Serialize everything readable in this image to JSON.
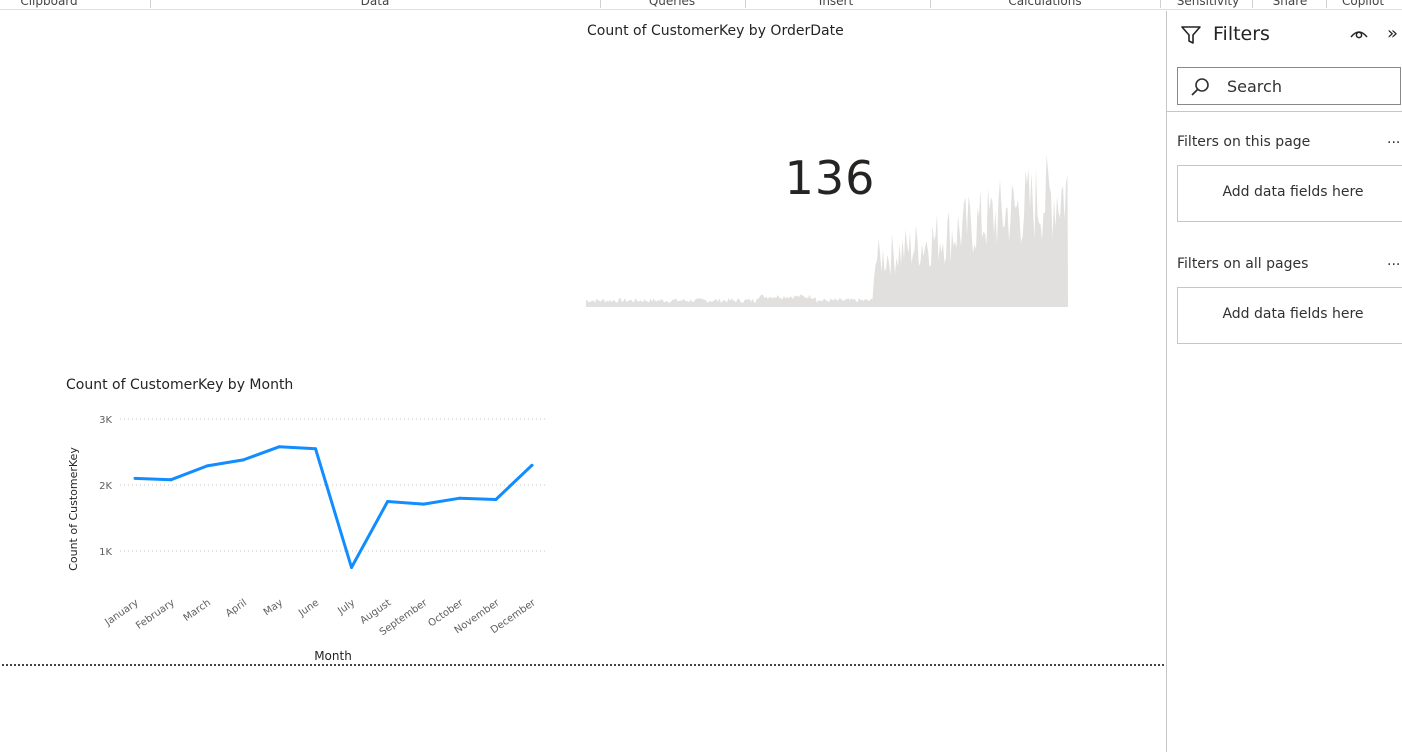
{
  "ribbon": {
    "groups": [
      "Clipboard",
      "Data",
      "Queries",
      "Insert",
      "Calculations",
      "Sensitivity",
      "Share",
      "Copilot"
    ]
  },
  "card_visual": {
    "title": "Count of CustomerKey by OrderDate",
    "value": "136"
  },
  "line_visual": {
    "title": "Count of CustomerKey by Month"
  },
  "filters_pane": {
    "title": "Filters",
    "search_placeholder": "Search",
    "sections": [
      {
        "label": "Filters on this page",
        "more": "...",
        "well_text": "Add data fields here"
      },
      {
        "label": "Filters on all pages",
        "more": "...",
        "well_text": "Add data fields here"
      }
    ]
  },
  "icons": {
    "filter": "filter-funnel-icon",
    "visibility": "eye-icon",
    "collapse": "double-chevron-right-icon",
    "search": "search-icon"
  },
  "colors": {
    "line_series": "#118DFF",
    "area_background": "#E1E0DE",
    "gridline": "#C8C6C4"
  },
  "chart_data": [
    {
      "type": "line",
      "title": "Count of CustomerKey by Month",
      "xlabel": "Month",
      "ylabel": "Count of CustomerKey",
      "categories": [
        "January",
        "February",
        "March",
        "April",
        "May",
        "June",
        "July",
        "August",
        "September",
        "October",
        "November",
        "December"
      ],
      "series": [
        {
          "values": [
            2100,
            2080,
            2290,
            2380,
            2580,
            2550,
            750,
            1750,
            1710,
            1800,
            1780,
            2300
          ]
        }
      ],
      "y_ticks": [
        "1K",
        "2K",
        "3K"
      ],
      "ylim": [
        500,
        3000
      ],
      "grid": true,
      "legend": "none"
    },
    {
      "type": "area",
      "title": "Count of CustomerKey by OrderDate",
      "note_value": "136",
      "shape": "low flat level for first ~60% of dates, then a sharp rise with high variance",
      "grid": false
    }
  ]
}
